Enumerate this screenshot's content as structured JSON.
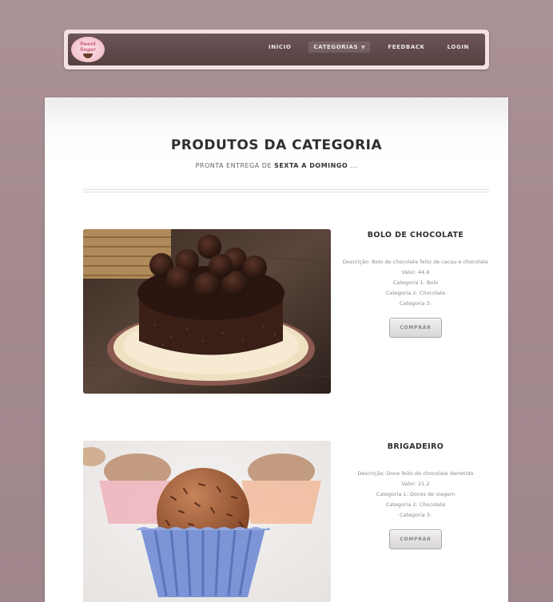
{
  "nav": {
    "logo_text_1": "Sweet",
    "logo_text_2": "Sugar",
    "items": [
      {
        "label": "INÍCIO"
      },
      {
        "label": "CATEGORIAS"
      },
      {
        "label": "FEEDBACK"
      },
      {
        "label": "LOGIN"
      }
    ]
  },
  "page": {
    "title": "PRODUTOS DA CATEGORIA",
    "subtitle_prefix": "PRONTA ENTREGA DE",
    "subtitle_bold": "SEXTA A DOMINGO",
    "subtitle_suffix": "..."
  },
  "products": [
    {
      "name": "BOLO DE CHOCOLATE",
      "description": "Descrição: Bolo de chocolate feito de cacau e chocolate",
      "value": "Valor: 44.6",
      "category1": "Categoria 1: Bolo",
      "category2": "Categoria 2: Chocolate",
      "category3": "Categoria 3:",
      "button": "COMPRAR"
    },
    {
      "name": "BRIGADEIRO",
      "description": "Descrição: Doce feito de chocolate derretido",
      "value": "Valor: 21.2",
      "category1": "Categoria 1: Doces de viagem",
      "category2": "Categoria 2: Chocolate",
      "category3": "Categoria 3:",
      "button": "COMPRAR"
    }
  ]
}
